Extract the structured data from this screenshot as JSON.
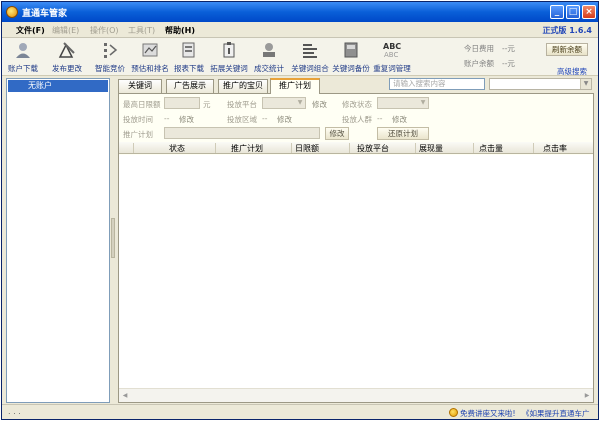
{
  "window": {
    "title": "直通车管家"
  },
  "menu": {
    "items": [
      {
        "label": "文件(F)",
        "enabled": true
      },
      {
        "label": "编辑(E)",
        "enabled": false
      },
      {
        "label": "操作(O)",
        "enabled": false
      },
      {
        "label": "工具(T)",
        "enabled": false
      },
      {
        "label": "帮助(H)",
        "enabled": true
      }
    ],
    "version": "正式版  1.6.4"
  },
  "toolbar": {
    "tools": [
      {
        "label": "账户下载",
        "icon": "user-download-icon"
      },
      {
        "label": "发布更改",
        "icon": "publish-icon"
      },
      {
        "label": "智能竞价",
        "icon": "smart-bid-icon"
      },
      {
        "label": "预估和排名",
        "icon": "ranking-icon"
      },
      {
        "label": "报表下载",
        "icon": "report-download-icon"
      },
      {
        "label": "拓展关键词",
        "icon": "keyword-expand-icon"
      },
      {
        "label": "成交统计",
        "icon": "deal-stats-icon"
      },
      {
        "label": "关键词组合",
        "icon": "keyword-combine-icon"
      },
      {
        "label": "关键词备份",
        "icon": "keyword-backup-icon"
      },
      {
        "label": "重复词管理",
        "icon": "abc-duplicate-icon"
      }
    ],
    "today_cost_label": "今日费用",
    "today_cost_value": "--元",
    "balance_label": "账户余额",
    "balance_value": "--元",
    "refresh_label": "刷新余额",
    "advanced_search": "高级搜索"
  },
  "left_panel": {
    "account": "无账户"
  },
  "tabs": [
    {
      "label": "关键词",
      "active": false
    },
    {
      "label": "广告展示",
      "active": false
    },
    {
      "label": "推广的宝贝",
      "active": false
    },
    {
      "label": "推广计划",
      "active": true
    }
  ],
  "search": {
    "placeholder": "请输入搜索内容"
  },
  "form": {
    "daily_limit_label": "最高日限额",
    "yuan": "元",
    "platform_label": "投放平台",
    "platform_edit": "修改",
    "status_label": "修改状态",
    "time_label": "投放时间",
    "time_value": "--",
    "time_edit": "修改",
    "region_label": "投放区域",
    "region_value": "--",
    "region_edit": "修改",
    "crowd_label": "投放人群",
    "crowd_value": "--",
    "crowd_edit": "修改",
    "plan_label": "推广计划",
    "plan_edit_button": "修改",
    "restore_button": "还原计划"
  },
  "table": {
    "columns": [
      "状态",
      "推广计划",
      "日限额",
      "投放平台",
      "展现量",
      "点击量",
      "点击率"
    ]
  },
  "status": {
    "dots": ". . .",
    "link1": "免费讲座又来啦!",
    "link2": "《如果提升直通车广"
  }
}
